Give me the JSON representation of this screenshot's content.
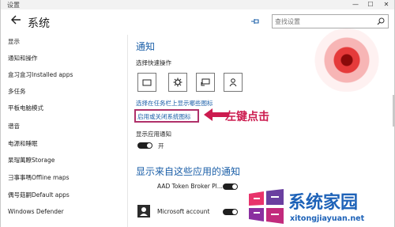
{
  "window": {
    "title": "设置",
    "minimize_glyph": "—",
    "maximize_glyph": "☐",
    "close_glyph": "✕"
  },
  "header": {
    "title": "系统",
    "search_placeholder": "查找设置"
  },
  "sidebar": {
    "items": [
      {
        "label": "显示"
      },
      {
        "label": "通知和操作"
      },
      {
        "label": "盒习盒习Installed apps"
      },
      {
        "label": "多任务"
      },
      {
        "label": "平板电脑模式"
      },
      {
        "label": "谱音"
      },
      {
        "label": "电源和睡眠"
      },
      {
        "label": "杲瑁萬瞭Storage"
      },
      {
        "label": "彐事事嗎Offline maps"
      },
      {
        "label": "偶号菇嗣Default apps"
      },
      {
        "label": "Windows Defender"
      }
    ]
  },
  "main": {
    "notifications_heading": "通知",
    "quick_actions_label": "选择快速操作",
    "quick_actions": [
      {
        "icon": "tablet-icon"
      },
      {
        "icon": "settings-icon"
      },
      {
        "icon": "connect-icon"
      },
      {
        "icon": "user-icon"
      }
    ],
    "taskbar_icons_link": "选择在任务栏上显示哪些图标",
    "system_icons_link": "启用或关闭系统图标",
    "show_app_notifications_label": "显示应用通知",
    "show_app_notifications_state": "开",
    "apps_heading": "显示来自这些应用的通知",
    "apps": [
      {
        "name": "AAD Token Broker Pl...",
        "icon": "aad-app-icon",
        "enabled": true
      },
      {
        "name": "Microsoft account",
        "icon": "account-app-icon",
        "enabled": true
      }
    ]
  },
  "annotation": {
    "text": "左键点击",
    "color": "#cc1b4f"
  },
  "watermark": {
    "text": "系统家园",
    "url": "xitongjiayuan.net"
  },
  "colors": {
    "accent": "#1b5fa8",
    "highlight_box": "#b0306a"
  }
}
